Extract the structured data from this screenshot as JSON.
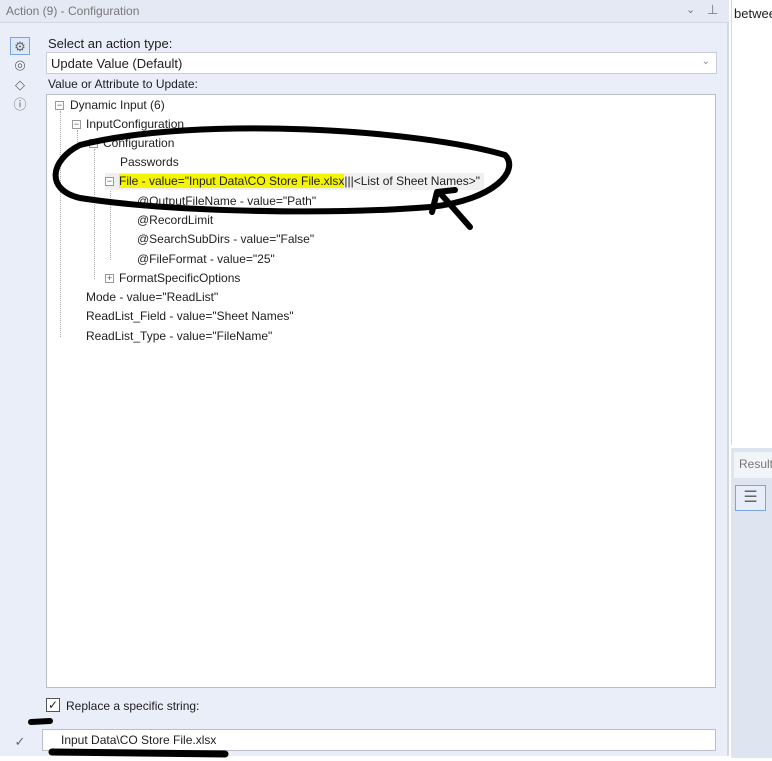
{
  "header": {
    "title": "Action (9) - Configuration",
    "collapse_icon": "chevron-down-icon",
    "pin_icon": "pin-icon"
  },
  "sidebar": {
    "icons": [
      "gear-icon",
      "connection-icon",
      "tag-icon",
      "help-icon"
    ],
    "bottom_icon": "check-circle-icon"
  },
  "action_type": {
    "label": "Select an action type:",
    "value": "Update Value (Default)"
  },
  "tree_label": "Value or Attribute to Update:",
  "tree": [
    {
      "text": "Dynamic Input (6)",
      "toggle": "−"
    },
    {
      "text": "InputConfiguration",
      "toggle": "−"
    },
    {
      "text": "Configuration",
      "toggle": "−"
    },
    {
      "text": "Passwords"
    },
    {
      "text_highlight": "File - value=\"Input Data\\CO Store File.xlsx",
      "text_rest": "|||<List of Sheet Names>\"",
      "toggle": "−"
    },
    {
      "text": "@OutputFileName - value=\"Path\""
    },
    {
      "text": "@RecordLimit"
    },
    {
      "text": "@SearchSubDirs - value=\"False\""
    },
    {
      "text": "@FileFormat - value=\"25\""
    },
    {
      "text": "FormatSpecificOptions",
      "toggle": "+"
    },
    {
      "text": "Mode - value=\"ReadList\""
    },
    {
      "text": "ReadList_Field - value=\"Sheet Names\""
    },
    {
      "text": "ReadList_Type - value=\"FileName\""
    }
  ],
  "replace": {
    "label": "Replace a specific string:",
    "checked": true,
    "check_mark": "✓",
    "value": "Input Data\\CO Store File.xlsx"
  },
  "right_panel": {
    "top_text": "betwee",
    "results_tab": "Results"
  }
}
